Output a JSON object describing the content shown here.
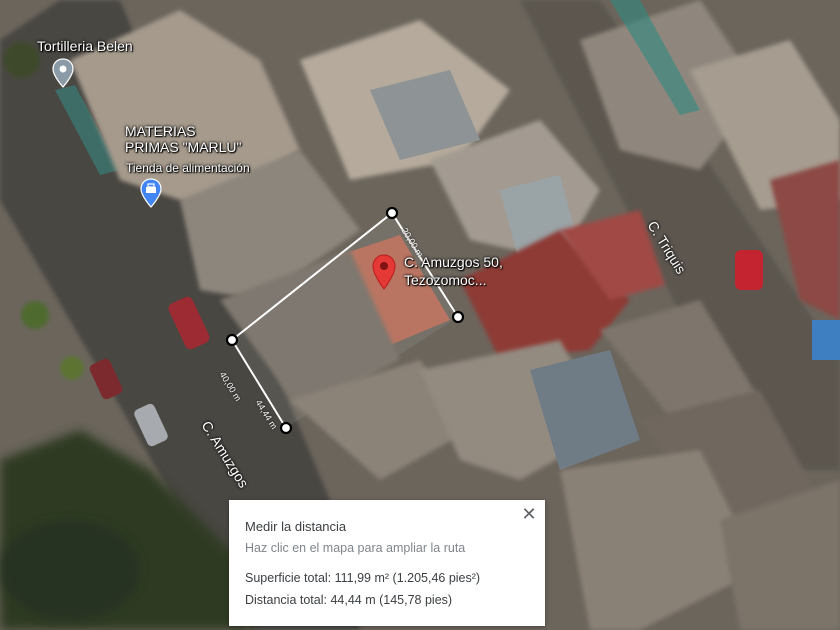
{
  "places": {
    "tortilleria": "Tortilleria Belen",
    "materias_line1": "MATERIAS",
    "materias_line2": "PRIMAS \"MARLU\"",
    "materias_category": "Tienda de alimentación"
  },
  "selected_place": {
    "line1": "C. Amuzgos 50,",
    "line2": "Tezozomoc..."
  },
  "streets": {
    "triquis": "C. Triquis",
    "amuzgos": "C. Amuzgos"
  },
  "measure_labels": {
    "segment_a": "40,00 m",
    "segment_b": "44,44 m",
    "segment_top": "20,00 m"
  },
  "measure_panel": {
    "title": "Medir la distancia",
    "hint": "Haz clic en el mapa para ampliar la ruta",
    "area": "Superficie total: 111,99 m² (1.205,46 pies²)",
    "distance": "Distancia total: 44,44 m (145,78 pies)",
    "close_symbol": "✕"
  },
  "colors": {
    "pin_red": "#e53935",
    "poi_blue": "#4285f4",
    "poi_gray": "#8a9aa6",
    "measure_line": "#ffffff"
  }
}
